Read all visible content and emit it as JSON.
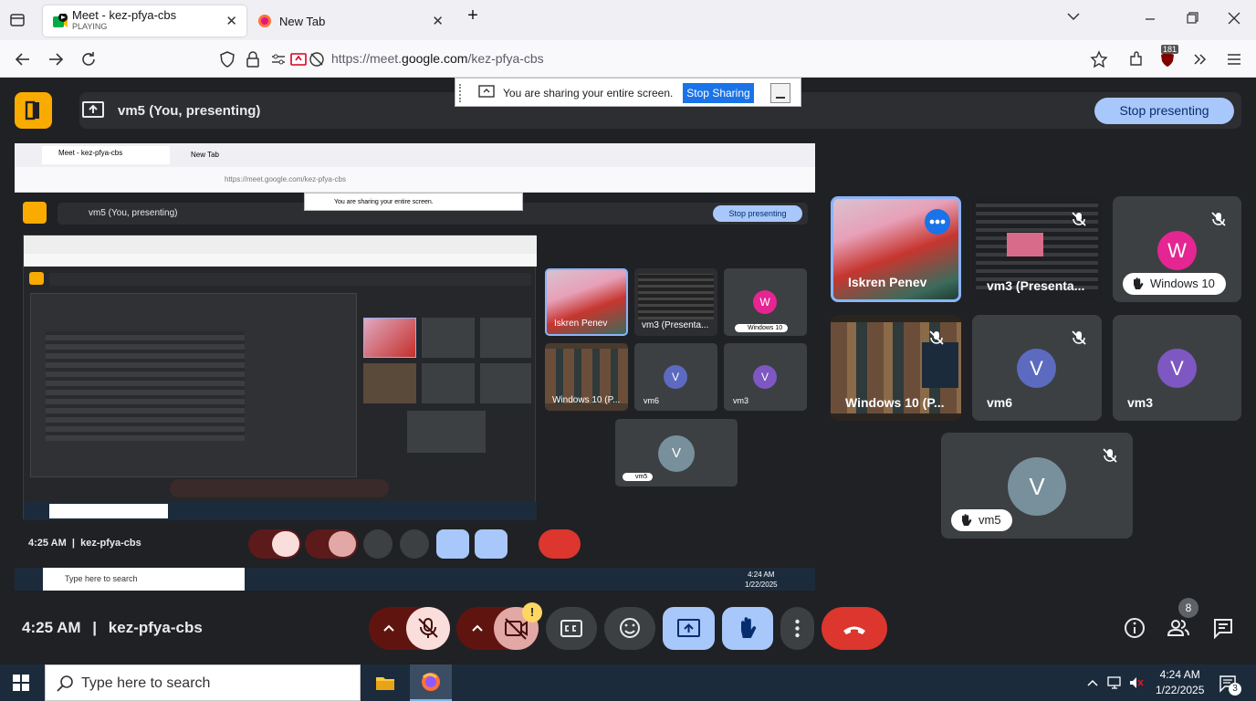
{
  "browser": {
    "tabs": [
      {
        "title": "Meet - kez-pfya-cbs",
        "subtitle": "PLAYING",
        "active": true
      },
      {
        "title": "New Tab",
        "active": false
      }
    ],
    "url_prefix": "https://meet.",
    "url_domain": "google.com",
    "url_path": "/kez-pfya-cbs",
    "extension_badge": "181"
  },
  "share_notice": {
    "text": "You are sharing your entire screen.",
    "stop_label": "Stop Sharing"
  },
  "meet": {
    "presenting_label": "vm5 (You, presenting)",
    "stop_presenting_label": "Stop presenting",
    "time": "4:25 AM",
    "meeting_code": "kez-pfya-cbs",
    "people_count": "8",
    "alert_badge": "!",
    "participants": [
      {
        "name": "Iskren Penev",
        "initial": "",
        "color": "#8ab4f8"
      },
      {
        "name": "vm3 (Presenta...",
        "initial": "",
        "color": "#5f6368"
      },
      {
        "name": "Windows 10",
        "initial": "W",
        "color": "#e52592"
      },
      {
        "name": "Windows 10 (P...",
        "initial": "",
        "color": "#5f6368"
      },
      {
        "name": "vm6",
        "initial": "V",
        "color": "#5c6bc0"
      },
      {
        "name": "vm3",
        "initial": "V",
        "color": "#7e57c2"
      },
      {
        "name": "vm5",
        "initial": "V",
        "color": "#78909c"
      }
    ]
  },
  "taskbar": {
    "search_placeholder": "Type here to search",
    "time": "4:24 AM",
    "date": "1/22/2025",
    "notif_count": "3"
  },
  "colors": {
    "meet_bg": "#202124",
    "tile_bg": "#3c4043",
    "accent_blue": "#a8c7fa",
    "end_call_red": "#dc362e",
    "logo_yellow": "#f9ab00"
  }
}
